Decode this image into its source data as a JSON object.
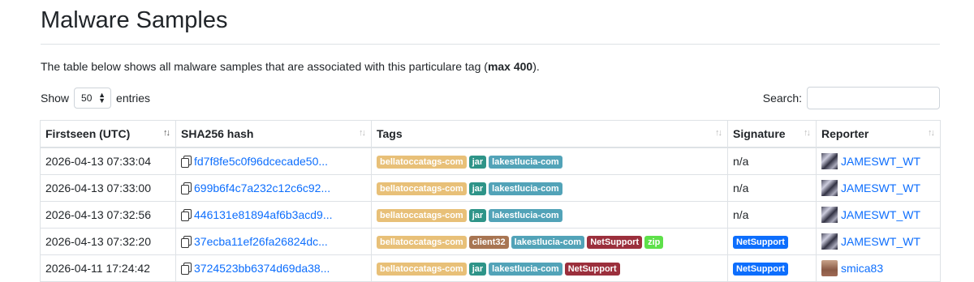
{
  "page": {
    "title": "Malware Samples",
    "intro_text": "The table below shows all malware samples that are associated with this particulare tag (",
    "intro_bold": "max 400",
    "intro_end": ")."
  },
  "controls": {
    "show_label": "Show",
    "entries_value": "50",
    "entries_label": "entries",
    "search_label": "Search:"
  },
  "table": {
    "headers": [
      "Firstseen (UTC)",
      "SHA256 hash",
      "Tags",
      "Signature",
      "Reporter"
    ],
    "rows": [
      {
        "firstseen": "2026-04-13 07:33:04",
        "hash": "fd7f8fe5c0f96dcecade50...",
        "tags": [
          "bellatoccatags-com",
          "jar",
          "lakestlucia-com"
        ],
        "signature": "n/a",
        "reporter": "JAMESWT_WT"
      },
      {
        "firstseen": "2026-04-13 07:33:00",
        "hash": "699b6f4c7a232c12c6c92...",
        "tags": [
          "bellatoccatags-com",
          "jar",
          "lakestlucia-com"
        ],
        "signature": "n/a",
        "reporter": "JAMESWT_WT"
      },
      {
        "firstseen": "2026-04-13 07:32:56",
        "hash": "446131e81894af6b3acd9...",
        "tags": [
          "bellatoccatags-com",
          "jar",
          "lakestlucia-com"
        ],
        "signature": "n/a",
        "reporter": "JAMESWT_WT"
      },
      {
        "firstseen": "2026-04-13 07:32:20",
        "hash": "37ecba11ef26fa26824dc...",
        "tags": [
          "bellatoccatags-com",
          "client32",
          "lakestlucia-com",
          "NetSupport",
          "zip"
        ],
        "signature": "NetSupport",
        "reporter": "JAMESWT_WT"
      },
      {
        "firstseen": "2026-04-11 17:24:42",
        "hash": "3724523bb6374d69da38...",
        "tags": [
          "bellatoccatags-com",
          "jar",
          "lakestlucia-com",
          "NetSupport"
        ],
        "signature": "NetSupport",
        "reporter": "smica83"
      }
    ]
  },
  "tag_colors": {
    "bellatoccatags-com": "#e8c078",
    "jar": "#2e9488",
    "lakestlucia-com": "#52a3b8",
    "client32": "#a87552",
    "NetSupport": "#9b2f3c",
    "zip": "#5ee04a"
  },
  "signature_color": "#0d6efd",
  "link_color": "#0d6efd"
}
